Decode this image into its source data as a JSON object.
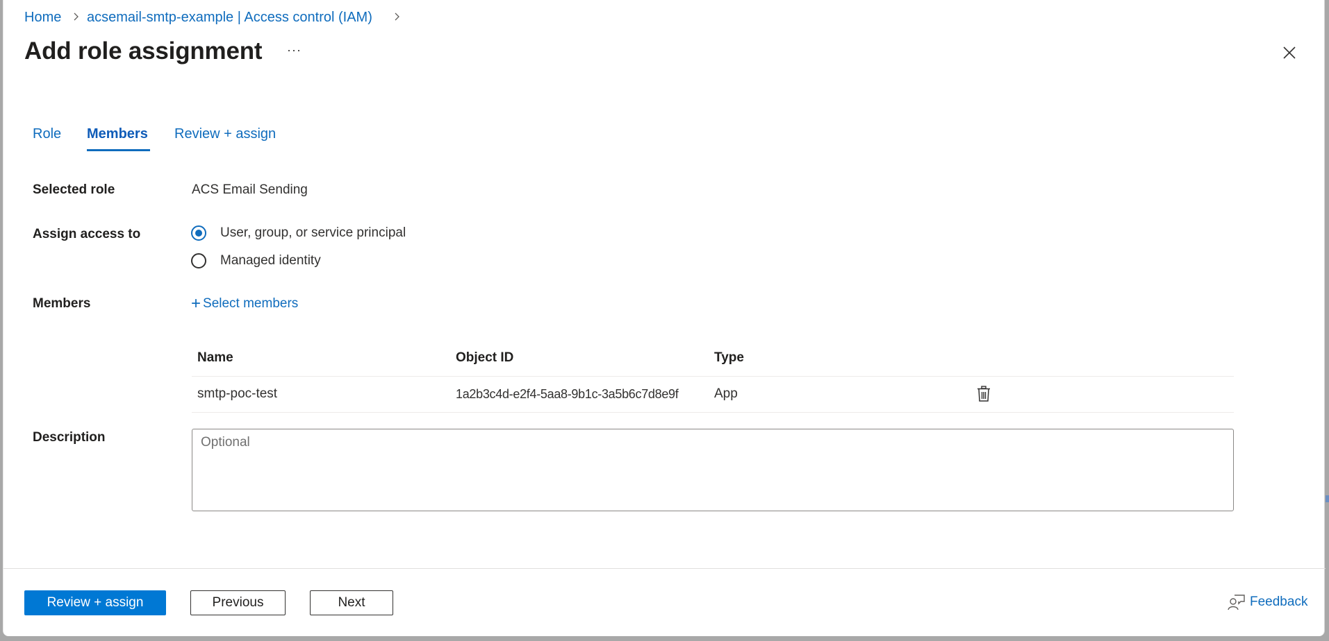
{
  "breadcrumb": {
    "items": [
      {
        "label": "Home"
      },
      {
        "label": "acsemail-smtp-example | Access control (IAM)"
      }
    ]
  },
  "header": {
    "title": "Add role assignment",
    "more_label": "···",
    "close_icon": "close-icon"
  },
  "tabs": [
    {
      "label": "Role",
      "active": false
    },
    {
      "label": "Members",
      "active": true
    },
    {
      "label": "Review + assign",
      "active": false
    }
  ],
  "form": {
    "selected_role": {
      "label": "Selected role",
      "value": "ACS Email Sending"
    },
    "assign_access": {
      "label": "Assign access to",
      "options": [
        {
          "label": "User, group, or service principal",
          "checked": true
        },
        {
          "label": "Managed identity",
          "checked": false
        }
      ]
    },
    "members": {
      "label": "Members",
      "add_label": "Select members",
      "add_icon": "plus-icon",
      "table": {
        "columns": [
          "Name",
          "Object ID",
          "Type"
        ],
        "rows": [
          {
            "name": "smtp-poc-test",
            "object_id": "1a2b3c4d-e2f4-5aa8-9b1c-3a5b6c7d8e9f",
            "type": "App",
            "action_icon": "trash-icon"
          }
        ]
      }
    },
    "description": {
      "label": "Description",
      "value": "",
      "placeholder": "Optional"
    }
  },
  "footer": {
    "primary_label": "Review + assign",
    "previous_label": "Previous",
    "next_label": "Next",
    "feedback_label": "Feedback"
  },
  "colors": {
    "accent": "#0078d4",
    "link": "#0f6cbd",
    "text": "#201f1e"
  }
}
